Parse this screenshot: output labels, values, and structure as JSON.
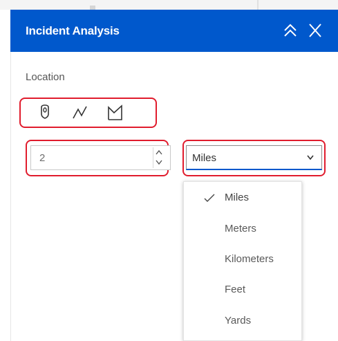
{
  "header": {
    "title": "Incident Analysis",
    "collapse_icon": "double-chevron-up-icon",
    "close_icon": "close-icon",
    "background": "#0058cc"
  },
  "location": {
    "label": "Location",
    "tools": [
      {
        "name": "point-tool",
        "icon": "pin-icon"
      },
      {
        "name": "line-tool",
        "icon": "polyline-icon"
      },
      {
        "name": "polygon-tool",
        "icon": "polygon-icon"
      }
    ]
  },
  "distance": {
    "value": "2"
  },
  "unit": {
    "selected": "Miles",
    "options": [
      {
        "label": "Miles",
        "selected": true
      },
      {
        "label": "Meters",
        "selected": false
      },
      {
        "label": "Kilometers",
        "selected": false
      },
      {
        "label": "Feet",
        "selected": false
      },
      {
        "label": "Yards",
        "selected": false
      }
    ]
  },
  "colors": {
    "accent": "#0058cc",
    "highlight": "#e01b2c"
  }
}
